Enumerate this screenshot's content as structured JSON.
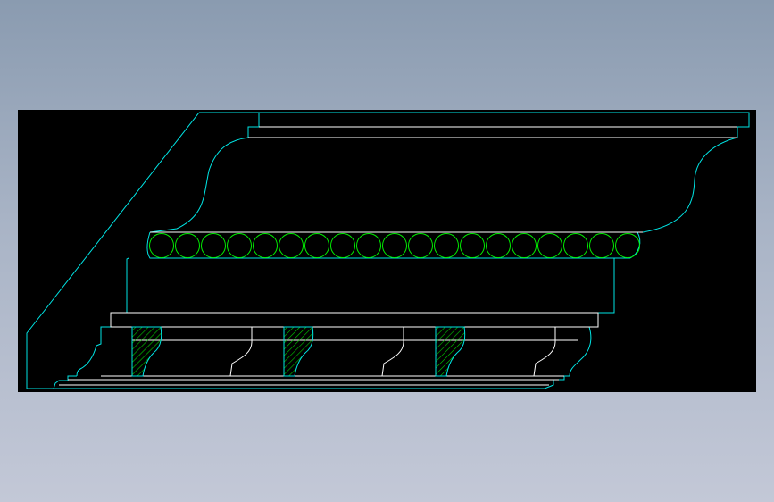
{
  "drawing": {
    "subject": "cornice-molding-profile",
    "colors": {
      "background": "#000000",
      "outline": "#00e5e5",
      "detail_lines": "#ffffff",
      "bead_circles": "#00ee00",
      "hatch": "#00cc00"
    },
    "bead_count": 19,
    "dentil_blocks": 3
  }
}
